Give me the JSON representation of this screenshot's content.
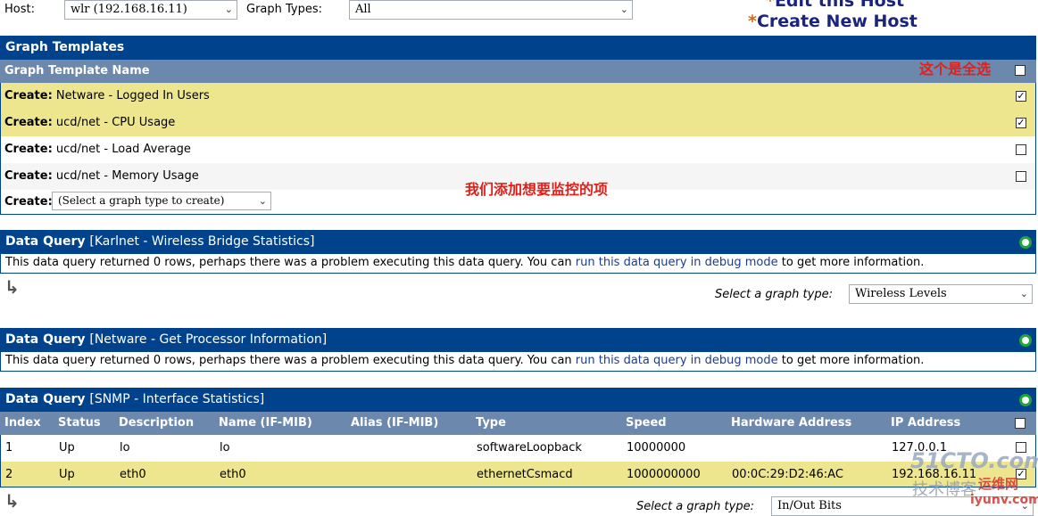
{
  "filter": {
    "host_label": "Host:",
    "host_value": "wlr (192.168.16.11)",
    "graph_types_label": "Graph Types:",
    "graph_types_value": "All"
  },
  "nav": {
    "star": "*",
    "edit_host": "Edit this Host",
    "create_host": "Create New Host"
  },
  "graph_templates": {
    "title": "Graph Templates",
    "column_header": "Graph Template Name",
    "create_prefix": "Create:",
    "rows": [
      {
        "name": "Netware - Logged In Users",
        "checked": true
      },
      {
        "name": "ucd/net - CPU Usage",
        "checked": true
      },
      {
        "name": "ucd/net - Load Average",
        "checked": false
      },
      {
        "name": "ucd/net - Memory Usage",
        "checked": false
      }
    ],
    "create_select_placeholder": "(Select a graph type to create)"
  },
  "annotations": {
    "select_all": "这个是全选",
    "add_items": "我们添加想要监控的项"
  },
  "queries": [
    {
      "label": "Data Query",
      "name": "[Karlnet - Wireless Bridge Statistics]",
      "message_prefix": "This data query returned 0 rows, perhaps there was a problem executing this data query. You can ",
      "message_link": "run this data query in debug mode",
      "message_suffix": " to get more information.",
      "graph_type_label": "Select a graph type:",
      "graph_type_value": "Wireless Levels"
    },
    {
      "label": "Data Query",
      "name": "[Netware - Get Processor Information]",
      "message_prefix": "This data query returned 0 rows, perhaps there was a problem executing this data query. You can ",
      "message_link": "run this data query in debug mode",
      "message_suffix": " to get more information."
    },
    {
      "label": "Data Query",
      "name": "[SNMP - Interface Statistics]",
      "columns": [
        "Index",
        "Status",
        "Description",
        "Name (IF-MIB)",
        "Alias (IF-MIB)",
        "Type",
        "Speed",
        "Hardware Address",
        "IP Address"
      ],
      "rows": [
        {
          "index": "1",
          "status": "Up",
          "description": "lo",
          "name": "lo",
          "alias": "",
          "type": "softwareLoopback",
          "speed": "10000000",
          "hw": "",
          "ip": "127.0.0.1",
          "checked": false
        },
        {
          "index": "2",
          "status": "Up",
          "description": "eth0",
          "name": "eth0",
          "alias": "",
          "type": "ethernetCsmacd",
          "speed": "1000000000",
          "hw": "00:0C:29:D2:46:AC",
          "ip": "192.168.16.11",
          "checked": true
        }
      ],
      "graph_type_label": "Select a graph type:",
      "graph_type_value": "In/Out Bits"
    }
  ],
  "watermark": {
    "brand": "51CTO.com",
    "sub": "技术博客",
    "sub2": "运维网",
    "url": "iyunv.com"
  },
  "colors": {
    "header_blue": "#00438c",
    "column_header": "#6d88ad",
    "selected_row": "#ede68e",
    "annotation_red": "#e0201a"
  }
}
